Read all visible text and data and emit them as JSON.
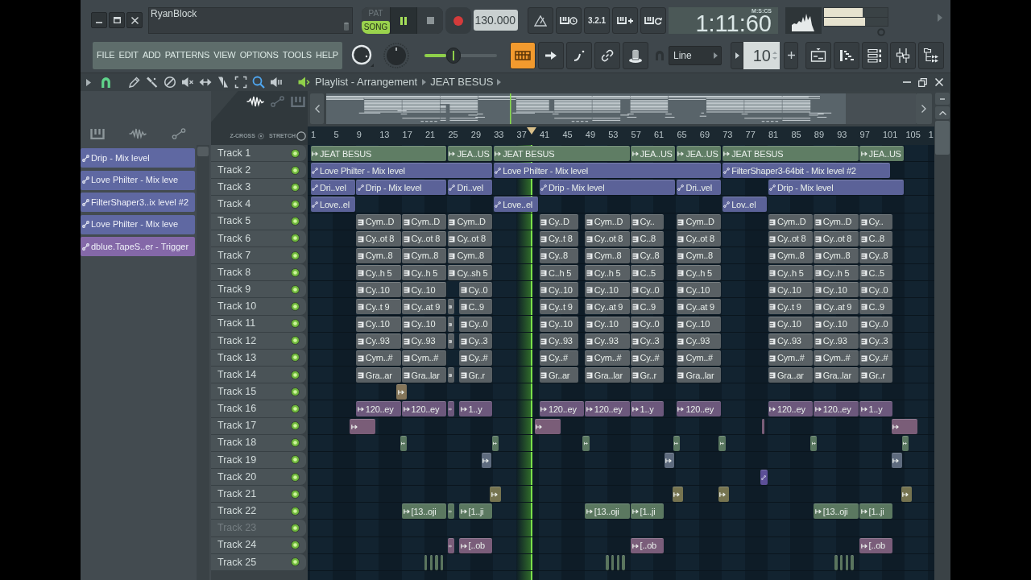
{
  "hint_bar": {
    "text": "RyanBlock"
  },
  "transport": {
    "modes": [
      {
        "label": "PAT",
        "selected": false
      },
      {
        "label": "SONG",
        "selected": true
      }
    ],
    "playing": true,
    "tempo": "130.000",
    "countdown": "3.2.1"
  },
  "time": {
    "value": "1:11:60",
    "unit": "M:S:CS"
  },
  "meters": [
    {
      "level": 0.61
    },
    {
      "level": 0.64
    }
  ],
  "menu": [
    "FILE",
    "EDIT",
    "ADD",
    "PATTERNS",
    "VIEW",
    "OPTIONS",
    "TOOLS",
    "HELP"
  ],
  "slider": {
    "level": 0.3
  },
  "toggles": [
    {
      "kind": "keyboard",
      "on": true
    },
    {
      "kind": "arrow",
      "on": false
    },
    {
      "kind": "curve",
      "on": false
    },
    {
      "kind": "link",
      "on": false
    },
    {
      "kind": "dial",
      "on": false
    }
  ],
  "snap": {
    "value": "Line"
  },
  "stepper": {
    "value": "10"
  },
  "playlist": {
    "title": "Playlist - Arrangement",
    "breadcrumb": "JEAT BESUS",
    "snap_on": true,
    "tools": [
      {
        "kind": "draw",
        "selected": false
      },
      {
        "kind": "paint",
        "selected": false
      },
      {
        "kind": "delete",
        "selected": false
      },
      {
        "kind": "mute",
        "selected": false
      },
      {
        "kind": "slip",
        "selected": false
      },
      {
        "kind": "slice",
        "selected": false
      },
      {
        "kind": "select",
        "selected": false
      },
      {
        "kind": "zoom",
        "selected": true
      },
      {
        "kind": "playback",
        "selected": false
      }
    ]
  },
  "filters": [
    {
      "kind": "audio",
      "selected": true
    },
    {
      "kind": "automation",
      "selected": false
    },
    {
      "kind": "pattern",
      "selected": false
    }
  ],
  "z_cross": "Z-CROSS",
  "stretch": "STRETCH",
  "picker": [
    {
      "label": "Drip - Mix level",
      "color": "#5f68a2"
    },
    {
      "label": "Love Philter - Mix leve",
      "color": "#5f68a2"
    },
    {
      "label": "FilterShaper3..ix level #2",
      "color": "#5f68a2"
    },
    {
      "label": "Love Philter - Mix leve",
      "color": "#5f68a2"
    },
    {
      "label": "dblue.TapeS..er - Trigger",
      "color": "#8468a8"
    }
  ],
  "ruler": [
    "1",
    "5",
    "9",
    "13",
    "17",
    "21",
    "25",
    "29",
    "33",
    "37",
    "41",
    "45",
    "49",
    "53",
    "57",
    "61",
    "65",
    "69",
    "73",
    "77",
    "81",
    "85",
    "89",
    "93",
    "97",
    "101",
    "105",
    "1"
  ],
  "tracks": [
    {
      "name": "Track 1",
      "on": true,
      "color": "#5f7d64",
      "clips": [
        {
          "kind": "audio",
          "label": "JEAT BESUS"
        },
        {
          "kind": "audio",
          "label": "JEA..US"
        },
        {
          "kind": "audio",
          "label": "JEAT BESUS"
        },
        {
          "kind": "audio",
          "label": "JEA..US"
        },
        {
          "kind": "audio",
          "label": "JEA..US"
        },
        {
          "kind": "audio",
          "label": "JEAT BESUS"
        },
        {
          "kind": "audio",
          "label": "JEA..US"
        }
      ]
    },
    {
      "name": "Track 2",
      "on": true,
      "color": "#5b6298",
      "clips": [
        {
          "kind": "automation",
          "label": "Love Philter - Mix level"
        },
        {
          "kind": "automation",
          "label": "Love Philter - Mix level"
        },
        {
          "kind": "automation",
          "label": "FilterShaper3-64bit - Mix level #2"
        }
      ]
    },
    {
      "name": "Track 3",
      "on": true,
      "color": "#5b6298",
      "clips": [
        {
          "kind": "automation",
          "label": "Dri..vel"
        },
        {
          "kind": "automation",
          "label": "Drip - Mix level"
        },
        {
          "kind": "automation",
          "label": "Dri..vel"
        },
        {
          "kind": "automation",
          "label": "Drip - Mix level"
        },
        {
          "kind": "automation",
          "label": "Dri..vel"
        },
        {
          "kind": "automation",
          "label": "Drip - Mix level"
        }
      ]
    },
    {
      "name": "Track 4",
      "on": true,
      "color": "#5b6298",
      "clips": [
        {
          "kind": "automation",
          "label": "Love..el"
        },
        {
          "kind": "automation",
          "label": "Love..el"
        },
        {
          "kind": "automation",
          "label": "Lov..el"
        }
      ]
    },
    {
      "name": "Track 5",
      "on": true,
      "color": "#596064",
      "clips": [
        {
          "kind": "pattern",
          "label": "Cym..D"
        },
        {
          "kind": "pattern",
          "label": "Cym..D"
        },
        {
          "kind": "pattern",
          "label": "Cym..D"
        },
        {
          "kind": "pattern",
          "label": "Cy..D"
        },
        {
          "kind": "pattern",
          "label": "Cym..D"
        },
        {
          "kind": "pattern",
          "label": "Cy.."
        },
        {
          "kind": "pattern",
          "label": "Cym..D"
        },
        {
          "kind": "pattern",
          "label": "Cym..D"
        },
        {
          "kind": "pattern",
          "label": "Cym..D"
        },
        {
          "kind": "pattern",
          "label": "Cy.."
        }
      ]
    },
    {
      "name": "Track 6",
      "on": true,
      "color": "#596064",
      "clips": [
        {
          "kind": "pattern",
          "label": "Cy..ot 8"
        },
        {
          "kind": "pattern",
          "label": "Cy..ot 8"
        },
        {
          "kind": "pattern",
          "label": "Cy..ot 8"
        },
        {
          "kind": "pattern",
          "label": "Cy..t 8"
        },
        {
          "kind": "pattern",
          "label": "Cy..ot 8"
        },
        {
          "kind": "pattern",
          "label": "C..8"
        },
        {
          "kind": "pattern",
          "label": "Cy..ot 8"
        },
        {
          "kind": "pattern",
          "label": "Cy..ot 8"
        },
        {
          "kind": "pattern",
          "label": "Cy..ot 8"
        },
        {
          "kind": "pattern",
          "label": "C..8"
        }
      ]
    },
    {
      "name": "Track 7",
      "on": true,
      "color": "#596064",
      "clips": [
        {
          "kind": "pattern",
          "label": "Cym..8"
        },
        {
          "kind": "pattern",
          "label": "Cym..8"
        },
        {
          "kind": "pattern",
          "label": "Cym..8"
        },
        {
          "kind": "pattern",
          "label": "Cy..8"
        },
        {
          "kind": "pattern",
          "label": "Cym..8"
        },
        {
          "kind": "pattern",
          "label": "Cy..8"
        },
        {
          "kind": "pattern",
          "label": "Cym..8"
        },
        {
          "kind": "pattern",
          "label": "Cym..8"
        },
        {
          "kind": "pattern",
          "label": "Cym..8"
        },
        {
          "kind": "pattern",
          "label": "Cy..8"
        }
      ]
    },
    {
      "name": "Track 8",
      "on": true,
      "color": "#596064",
      "clips": [
        {
          "kind": "pattern",
          "label": "Cy..h 5"
        },
        {
          "kind": "pattern",
          "label": "Cy..h 5"
        },
        {
          "kind": "pattern",
          "label": "Cy..sh 5"
        },
        {
          "kind": "pattern",
          "label": "C..h 5"
        },
        {
          "kind": "pattern",
          "label": "Cy..h 5"
        },
        {
          "kind": "pattern",
          "label": "C..5"
        },
        {
          "kind": "pattern",
          "label": "Cy..h 5"
        },
        {
          "kind": "pattern",
          "label": "Cy..h 5"
        },
        {
          "kind": "pattern",
          "label": "Cy..h 5"
        },
        {
          "kind": "pattern",
          "label": "C..5"
        }
      ]
    },
    {
      "name": "Track 9",
      "on": true,
      "color": "#596064",
      "clips": [
        {
          "kind": "pattern",
          "label": "Cy..10"
        },
        {
          "kind": "pattern",
          "label": "Cy..10"
        },
        {
          "kind": "pattern",
          "label": "Cy..0"
        },
        {
          "kind": "pattern",
          "label": "Cy..10"
        },
        {
          "kind": "pattern",
          "label": "Cy..10"
        },
        {
          "kind": "pattern",
          "label": "Cy..0"
        },
        {
          "kind": "pattern",
          "label": "Cy..10"
        },
        {
          "kind": "pattern",
          "label": "Cy..10"
        },
        {
          "kind": "pattern",
          "label": "Cy..10"
        },
        {
          "kind": "pattern",
          "label": "Cy..0"
        }
      ]
    },
    {
      "name": "Track 10",
      "on": true,
      "color": "#596064",
      "clips": [
        {
          "kind": "pattern",
          "label": "Cy..t 9"
        },
        {
          "kind": "pattern",
          "label": "Cy..at 9"
        },
        {
          "kind": "pattern"
        },
        {
          "kind": "pattern",
          "label": "C..9"
        },
        {
          "kind": "pattern",
          "label": "Cy..t 9"
        },
        {
          "kind": "pattern",
          "label": "Cy..at 9"
        },
        {
          "kind": "pattern",
          "label": "C..9"
        },
        {
          "kind": "pattern",
          "label": "Cy..at 9"
        },
        {
          "kind": "pattern",
          "label": "Cy..t 9"
        },
        {
          "kind": "pattern",
          "label": "Cy..at 9"
        },
        {
          "kind": "pattern",
          "label": "C..9"
        }
      ]
    },
    {
      "name": "Track 11",
      "on": true,
      "color": "#596064",
      "clips": [
        {
          "kind": "pattern",
          "label": "Cy..10"
        },
        {
          "kind": "pattern",
          "label": "Cy..10"
        },
        {
          "kind": "pattern"
        },
        {
          "kind": "pattern",
          "label": "Cy..0"
        },
        {
          "kind": "pattern",
          "label": "Cy..10"
        },
        {
          "kind": "pattern",
          "label": "Cy..10"
        },
        {
          "kind": "pattern",
          "label": "Cy..0"
        },
        {
          "kind": "pattern",
          "label": "Cy..10"
        },
        {
          "kind": "pattern",
          "label": "Cy..10"
        },
        {
          "kind": "pattern",
          "label": "Cy..10"
        },
        {
          "kind": "pattern",
          "label": "Cy..0"
        }
      ]
    },
    {
      "name": "Track 12",
      "on": true,
      "color": "#596064",
      "clips": [
        {
          "kind": "pattern",
          "label": "Cy..93"
        },
        {
          "kind": "pattern",
          "label": "Cy..93"
        },
        {
          "kind": "pattern"
        },
        {
          "kind": "pattern",
          "label": "Cy..3"
        },
        {
          "kind": "pattern",
          "label": "Cy..93"
        },
        {
          "kind": "pattern",
          "label": "Cy..93"
        },
        {
          "kind": "pattern",
          "label": "Cy..3"
        },
        {
          "kind": "pattern",
          "label": "Cy..93"
        },
        {
          "kind": "pattern",
          "label": "Cy..93"
        },
        {
          "kind": "pattern",
          "label": "Cy..93"
        },
        {
          "kind": "pattern",
          "label": "Cy..3"
        }
      ]
    },
    {
      "name": "Track 13",
      "on": true,
      "color": "#596064",
      "clips": [
        {
          "kind": "pattern",
          "label": "Cym..#"
        },
        {
          "kind": "pattern",
          "label": "Cym..#"
        },
        {
          "kind": "pattern",
          "label": "Cy..#"
        },
        {
          "kind": "pattern",
          "label": "Cy..#"
        },
        {
          "kind": "pattern",
          "label": "Cym..#"
        },
        {
          "kind": "pattern",
          "label": "Cy..#"
        },
        {
          "kind": "pattern",
          "label": "Cym..#"
        },
        {
          "kind": "pattern",
          "label": "Cym..#"
        },
        {
          "kind": "pattern",
          "label": "Cym..#"
        },
        {
          "kind": "pattern",
          "label": "Cy..#"
        }
      ]
    },
    {
      "name": "Track 14",
      "on": true,
      "color": "#596064",
      "clips": [
        {
          "kind": "pattern",
          "label": "Gra..ar"
        },
        {
          "kind": "pattern",
          "label": "Gra..lar"
        },
        {
          "kind": "pattern"
        },
        {
          "kind": "pattern",
          "label": "Gr..r"
        },
        {
          "kind": "pattern",
          "label": "Gr..ar"
        },
        {
          "kind": "pattern",
          "label": "Gra..lar"
        },
        {
          "kind": "pattern",
          "label": "Gr..r"
        },
        {
          "kind": "pattern",
          "label": "Gra..lar"
        },
        {
          "kind": "pattern",
          "label": "Gra..ar"
        },
        {
          "kind": "pattern",
          "label": "Gra..lar"
        },
        {
          "kind": "pattern",
          "label": "Gr..r"
        }
      ]
    },
    {
      "name": "Track 15",
      "on": true,
      "color": "#85765a",
      "clips": [
        {
          "kind": "audio"
        }
      ]
    },
    {
      "name": "Track 16",
      "on": true,
      "color": "#6c587c",
      "clips": [
        {
          "kind": "audio",
          "label": "120..ey"
        },
        {
          "kind": "audio",
          "label": "120..ey"
        },
        {
          "kind": "audio"
        },
        {
          "kind": "audio",
          "label": "1..y"
        },
        {
          "kind": "audio",
          "label": "120..ey"
        },
        {
          "kind": "audio",
          "label": "120..ey"
        },
        {
          "kind": "audio",
          "label": "1..y"
        },
        {
          "kind": "audio",
          "label": "120..ey"
        },
        {
          "kind": "audio",
          "label": "120..ey"
        },
        {
          "kind": "audio",
          "label": "120..ey"
        },
        {
          "kind": "audio",
          "label": "1..y"
        }
      ]
    },
    {
      "name": "Track 17",
      "on": true,
      "color": "#7a5d78",
      "clips": [
        {
          "kind": "audio"
        },
        {
          "kind": "audio"
        },
        {
          "kind": "audio"
        },
        {
          "kind": "audio"
        }
      ]
    },
    {
      "name": "Track 18",
      "on": true,
      "color": "#5a7861",
      "clips": [
        {
          "kind": "audio"
        },
        {
          "kind": "audio"
        },
        {
          "kind": "audio"
        },
        {
          "kind": "audio"
        },
        {
          "kind": "audio"
        },
        {
          "kind": "audio"
        },
        {
          "kind": "audio"
        }
      ]
    },
    {
      "name": "Track 19",
      "on": true,
      "color": "#5e6b7e",
      "clips": [
        {
          "kind": "audio"
        },
        {
          "kind": "audio"
        },
        {
          "kind": "audio"
        }
      ]
    },
    {
      "name": "Track 20",
      "on": true,
      "color": "#5c4f98",
      "clips": [
        {
          "kind": "automation"
        }
      ]
    },
    {
      "name": "Track 21",
      "on": true,
      "color": "#767450",
      "clips": [
        {
          "kind": "audio"
        },
        {
          "kind": "audio"
        },
        {
          "kind": "audio"
        },
        {
          "kind": "audio"
        }
      ]
    },
    {
      "name": "Track 22",
      "on": true,
      "color": "#5b7860",
      "clips": [
        {
          "kind": "audio",
          "label": "[13..oji"
        },
        {
          "kind": "audio"
        },
        {
          "kind": "audio",
          "label": "[1..ji"
        },
        {
          "kind": "audio",
          "label": "[13..oji"
        },
        {
          "kind": "audio",
          "label": "[1..ji"
        },
        {
          "kind": "audio",
          "label": "[13..oji"
        },
        {
          "kind": "audio",
          "label": "[1..ji"
        }
      ]
    },
    {
      "name": "Track 23",
      "on": true
    },
    {
      "name": "Track 24",
      "on": true,
      "color": "#7a5d7a",
      "clips": [
        {
          "kind": "audio"
        },
        {
          "kind": "audio",
          "label": "[..ob"
        },
        {
          "kind": "audio",
          "label": "[..ob"
        },
        {
          "kind": "audio",
          "label": "[..ob"
        }
      ]
    },
    {
      "name": "Track 25",
      "on": true,
      "color": "#5a755e",
      "clips": [
        {
          "kind": "audio"
        },
        {
          "kind": "audio"
        },
        {
          "kind": "audio"
        },
        {
          "kind": "audio"
        },
        {
          "kind": "audio"
        },
        {
          "kind": "audio"
        },
        {
          "kind": "audio"
        },
        {
          "kind": "audio"
        },
        {
          "kind": "audio"
        },
        {
          "kind": "audio"
        },
        {
          "kind": "audio"
        },
        {
          "kind": "audio"
        }
      ]
    }
  ]
}
